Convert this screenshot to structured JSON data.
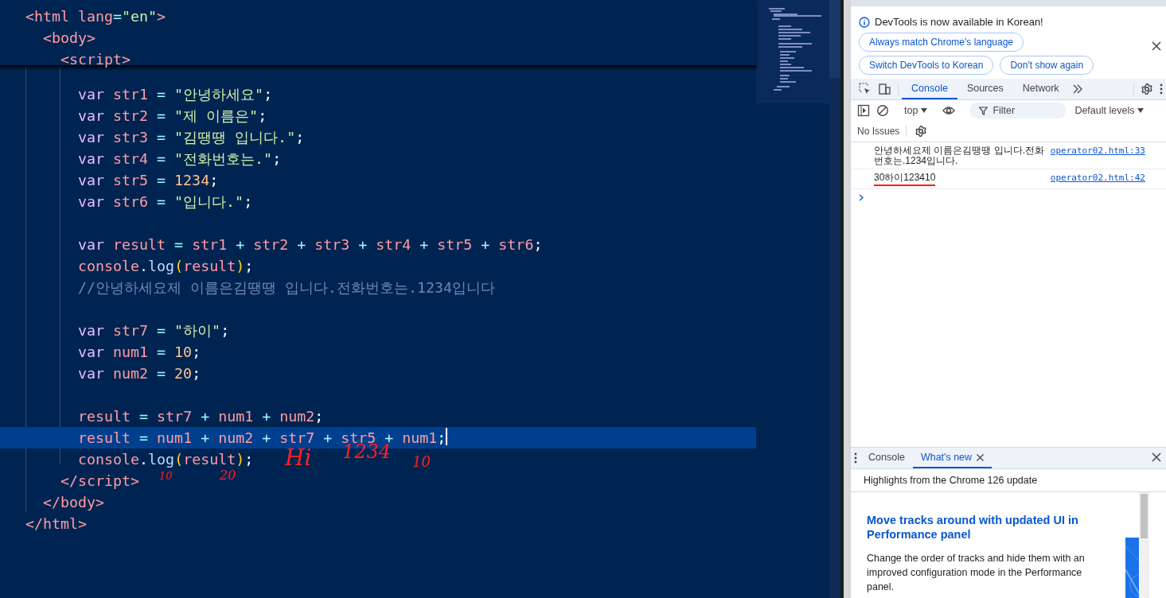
{
  "editor": {
    "sticky_lines": [
      {
        "segments": [
          {
            "kind": "tag",
            "text": "<html"
          },
          {
            "kind": "attr",
            "text": " lang"
          },
          {
            "kind": "op",
            "text": "="
          },
          {
            "kind": "str",
            "text": "\"en\""
          },
          {
            "kind": "tag",
            "text": ">"
          }
        ]
      },
      {
        "segments": [
          {
            "kind": "tag",
            "text": "  <body>"
          }
        ]
      },
      {
        "segments": [
          {
            "kind": "tag",
            "text": "    <script>"
          }
        ]
      }
    ],
    "lines": [
      {
        "current": false,
        "segments": [
          {
            "kind": "kw",
            "text": "      var "
          },
          {
            "kind": "var",
            "text": "str1 "
          },
          {
            "kind": "op",
            "text": "= "
          },
          {
            "kind": "str",
            "text": "\"안녕하세요\""
          },
          {
            "kind": "punct",
            "text": ";"
          }
        ]
      },
      {
        "current": false,
        "segments": [
          {
            "kind": "kw",
            "text": "      var "
          },
          {
            "kind": "var",
            "text": "str2 "
          },
          {
            "kind": "op",
            "text": "= "
          },
          {
            "kind": "str",
            "text": "\"제 이름은\""
          },
          {
            "kind": "punct",
            "text": ";"
          }
        ]
      },
      {
        "current": false,
        "segments": [
          {
            "kind": "kw",
            "text": "      var "
          },
          {
            "kind": "var",
            "text": "str3 "
          },
          {
            "kind": "op",
            "text": "= "
          },
          {
            "kind": "str",
            "text": "\"김땡땡 입니다.\""
          },
          {
            "kind": "punct",
            "text": ";"
          }
        ]
      },
      {
        "current": false,
        "segments": [
          {
            "kind": "kw",
            "text": "      var "
          },
          {
            "kind": "var",
            "text": "str4 "
          },
          {
            "kind": "op",
            "text": "= "
          },
          {
            "kind": "str",
            "text": "\"전화번호는.\""
          },
          {
            "kind": "punct",
            "text": ";"
          }
        ]
      },
      {
        "current": false,
        "segments": [
          {
            "kind": "kw",
            "text": "      var "
          },
          {
            "kind": "var",
            "text": "str5 "
          },
          {
            "kind": "op",
            "text": "= "
          },
          {
            "kind": "num",
            "text": "1234"
          },
          {
            "kind": "punct",
            "text": ";"
          }
        ]
      },
      {
        "current": false,
        "segments": [
          {
            "kind": "kw",
            "text": "      var "
          },
          {
            "kind": "var",
            "text": "str6 "
          },
          {
            "kind": "op",
            "text": "= "
          },
          {
            "kind": "str",
            "text": "\"입니다.\""
          },
          {
            "kind": "punct",
            "text": ";"
          }
        ]
      },
      {
        "current": false
      },
      {
        "current": false,
        "segments": [
          {
            "kind": "kw",
            "text": "      var "
          },
          {
            "kind": "var",
            "text": "result "
          },
          {
            "kind": "op",
            "text": "= "
          },
          {
            "kind": "var",
            "text": "str1 "
          },
          {
            "kind": "op",
            "text": "+ "
          },
          {
            "kind": "var",
            "text": "str2 "
          },
          {
            "kind": "op",
            "text": "+ "
          },
          {
            "kind": "var",
            "text": "str3 "
          },
          {
            "kind": "op",
            "text": "+ "
          },
          {
            "kind": "var",
            "text": "str4 "
          },
          {
            "kind": "op",
            "text": "+ "
          },
          {
            "kind": "var",
            "text": "str5 "
          },
          {
            "kind": "op",
            "text": "+ "
          },
          {
            "kind": "var",
            "text": "str6"
          },
          {
            "kind": "punct",
            "text": ";"
          }
        ]
      },
      {
        "current": false,
        "segments": [
          {
            "kind": "var",
            "text": "      console"
          },
          {
            "kind": "punct",
            "text": "."
          },
          {
            "kind": "fn",
            "text": "log"
          },
          {
            "kind": "paren",
            "text": "("
          },
          {
            "kind": "var",
            "text": "result"
          },
          {
            "kind": "paren",
            "text": ")"
          },
          {
            "kind": "punct",
            "text": ";"
          }
        ]
      },
      {
        "current": false,
        "segments": [
          {
            "kind": "comment",
            "text": "      //안녕하세요제 이름은김땡땡 입니다.전화번호는.1234입니다"
          }
        ]
      },
      {
        "current": false
      },
      {
        "current": false,
        "segments": [
          {
            "kind": "kw",
            "text": "      var "
          },
          {
            "kind": "var",
            "text": "str7 "
          },
          {
            "kind": "op",
            "text": "= "
          },
          {
            "kind": "str",
            "text": "\"하이\""
          },
          {
            "kind": "punct",
            "text": ";"
          }
        ]
      },
      {
        "current": false,
        "segments": [
          {
            "kind": "kw",
            "text": "      var "
          },
          {
            "kind": "var",
            "text": "num1 "
          },
          {
            "kind": "op",
            "text": "= "
          },
          {
            "kind": "num",
            "text": "10"
          },
          {
            "kind": "punct",
            "text": ";"
          }
        ]
      },
      {
        "current": false,
        "segments": [
          {
            "kind": "kw",
            "text": "      var "
          },
          {
            "kind": "var",
            "text": "num2 "
          },
          {
            "kind": "op",
            "text": "= "
          },
          {
            "kind": "num",
            "text": "20"
          },
          {
            "kind": "punct",
            "text": ";"
          }
        ]
      },
      {
        "current": false
      },
      {
        "current": false,
        "segments": [
          {
            "kind": "var",
            "text": "      result "
          },
          {
            "kind": "op",
            "text": "= "
          },
          {
            "kind": "var",
            "text": "str7 "
          },
          {
            "kind": "op",
            "text": "+ "
          },
          {
            "kind": "var",
            "text": "num1 "
          },
          {
            "kind": "op",
            "text": "+ "
          },
          {
            "kind": "var",
            "text": "num2"
          },
          {
            "kind": "punct",
            "text": ";"
          }
        ]
      },
      {
        "current": true,
        "segments": [
          {
            "kind": "var",
            "text": "      result "
          },
          {
            "kind": "op",
            "text": "= "
          },
          {
            "kind": "var",
            "text": "num1 "
          },
          {
            "kind": "op",
            "text": "+ "
          },
          {
            "kind": "var",
            "text": "num2 "
          },
          {
            "kind": "op",
            "text": "+ "
          },
          {
            "kind": "var",
            "text": "str7 "
          },
          {
            "kind": "op",
            "text": "+ "
          },
          {
            "kind": "var",
            "text": "str5 "
          },
          {
            "kind": "op",
            "text": "+ "
          },
          {
            "kind": "var",
            "text": "num1"
          },
          {
            "kind": "punct",
            "text": ";"
          }
        ]
      },
      {
        "current": false,
        "segments": [
          {
            "kind": "var",
            "text": "      console"
          },
          {
            "kind": "punct",
            "text": "."
          },
          {
            "kind": "fn",
            "text": "log"
          },
          {
            "kind": "paren",
            "text": "("
          },
          {
            "kind": "var",
            "text": "result"
          },
          {
            "kind": "paren",
            "text": ")"
          },
          {
            "kind": "punct",
            "text": ";"
          }
        ]
      },
      {
        "current": false,
        "segments": [
          {
            "kind": "tag",
            "text": "    </script>"
          }
        ]
      },
      {
        "current": false,
        "segments": [
          {
            "kind": "tag",
            "text": "  </body>"
          }
        ]
      },
      {
        "current": false,
        "segments": [
          {
            "kind": "tag",
            "text": "</html>"
          }
        ]
      },
      {
        "current": false
      }
    ],
    "annotations": [
      "10",
      "20",
      "Hi",
      "1234",
      "10"
    ]
  },
  "devtools": {
    "infobar": {
      "message": "DevTools is now available in Korean!",
      "buttons": [
        "Always match Chrome's language",
        "Switch DevTools to Korean",
        "Don't show again"
      ]
    },
    "tabs": [
      {
        "label": "Console",
        "selected": true
      },
      {
        "label": "Sources",
        "selected": false
      },
      {
        "label": "Network",
        "selected": false
      }
    ],
    "toolbar": {
      "context": "top",
      "filter_placeholder": "Filter",
      "levels": "Default levels"
    },
    "issues": "No Issues",
    "messages": [
      {
        "text": "안녕하세요제 이름은김땡땡 입니다.전화번호는.1234입니다.",
        "source": "operator02.html:33",
        "underlined": false
      },
      {
        "text": "30하이123410",
        "source": "operator02.html:42",
        "underlined": true
      }
    ],
    "drawer": {
      "tabs": [
        {
          "label": "Console",
          "selected": false,
          "closable": false
        },
        {
          "label": "What's new",
          "selected": true,
          "closable": true
        }
      ],
      "header": "Highlights from the Chrome 126 update",
      "article_title": "Move tracks around with updated UI in Performance panel",
      "article_body": "Change the order of tracks and hide them with an improved configuration mode in the Performance panel."
    }
  }
}
